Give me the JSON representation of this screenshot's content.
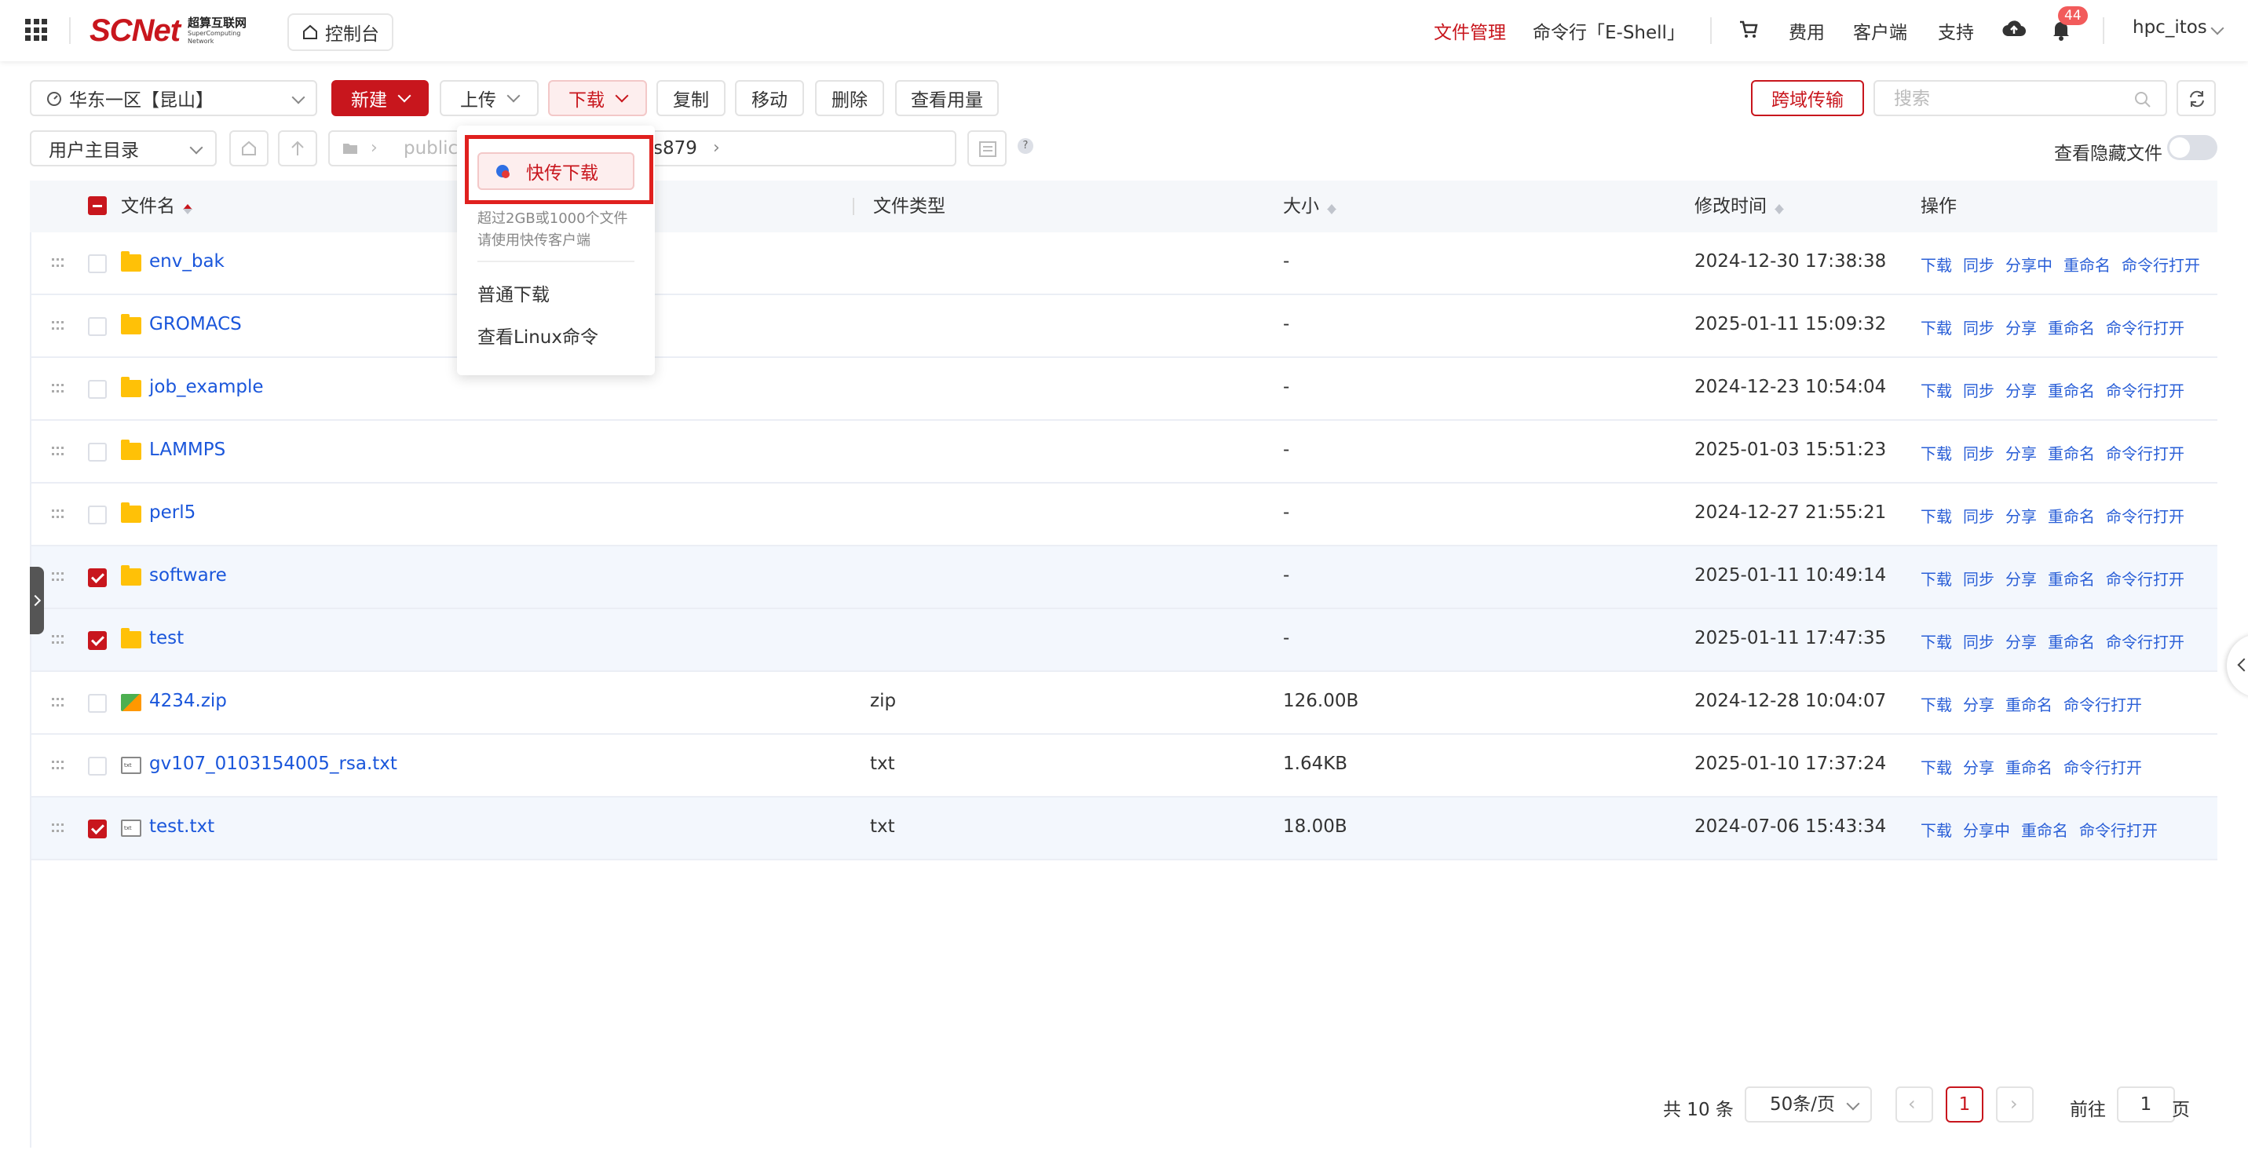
{
  "topbar": {
    "logo_main": "SCNet",
    "logo_cn": "超算互联网",
    "logo_en_1": "SuperComputing",
    "logo_en_2": "Network",
    "console": "控制台",
    "nav": {
      "files": "文件管理",
      "eshell": "命令行「E-Shell」",
      "fees": "费用",
      "client": "客户端",
      "support": "支持",
      "notification_count": "44",
      "user": "hpc_itos"
    }
  },
  "toolbar": {
    "region": "华东一区【昆山】",
    "new": "新建",
    "upload": "上传",
    "download": "下载",
    "copy": "复制",
    "move": "移动",
    "delete": "删除",
    "usage": "查看用量",
    "cross_transfer": "跨域传输",
    "search_placeholder": "搜索",
    "root_select": "用户主目录",
    "path_1": "public",
    "path_2": "s879",
    "show_hidden": "查看隐藏文件",
    "help_mark": "?"
  },
  "dropdown": {
    "fast_download": "快传下载",
    "hint_1": "超过2GB或1000个文件",
    "hint_2": "请使用快传客户端",
    "normal_download": "普通下载",
    "linux_cmd": "查看Linux命令"
  },
  "table": {
    "columns": {
      "name": "文件名",
      "type": "文件类型",
      "size": "大小",
      "mtime": "修改时间",
      "ops": "操作"
    },
    "rows": [
      {
        "name": "env_bak",
        "kind": "folder",
        "type": "",
        "size": "-",
        "mtime": "2024-12-30 17:38:38",
        "checked": false,
        "ops": [
          "下载",
          "同步",
          "分享中",
          "重命名",
          "命令行打开"
        ]
      },
      {
        "name": "GROMACS",
        "kind": "folder",
        "type": "",
        "size": "-",
        "mtime": "2025-01-11 15:09:32",
        "checked": false,
        "ops": [
          "下载",
          "同步",
          "分享",
          "重命名",
          "命令行打开"
        ]
      },
      {
        "name": "job_example",
        "kind": "folder",
        "type": "",
        "size": "-",
        "mtime": "2024-12-23 10:54:04",
        "checked": false,
        "ops": [
          "下载",
          "同步",
          "分享",
          "重命名",
          "命令行打开"
        ]
      },
      {
        "name": "LAMMPS",
        "kind": "folder",
        "type": "",
        "size": "-",
        "mtime": "2025-01-03 15:51:23",
        "checked": false,
        "ops": [
          "下载",
          "同步",
          "分享",
          "重命名",
          "命令行打开"
        ]
      },
      {
        "name": "perl5",
        "kind": "folder",
        "type": "",
        "size": "-",
        "mtime": "2024-12-27 21:55:21",
        "checked": false,
        "ops": [
          "下载",
          "同步",
          "分享",
          "重命名",
          "命令行打开"
        ]
      },
      {
        "name": "software",
        "kind": "folder",
        "type": "",
        "size": "-",
        "mtime": "2025-01-11 10:49:14",
        "checked": true,
        "ops": [
          "下载",
          "同步",
          "分享",
          "重命名",
          "命令行打开"
        ]
      },
      {
        "name": "test",
        "kind": "folder",
        "type": "",
        "size": "-",
        "mtime": "2025-01-11 17:47:35",
        "checked": true,
        "ops": [
          "下载",
          "同步",
          "分享",
          "重命名",
          "命令行打开"
        ]
      },
      {
        "name": "4234.zip",
        "kind": "zip",
        "type": "zip",
        "size": "126.00B",
        "mtime": "2024-12-28 10:04:07",
        "checked": false,
        "ops": [
          "下载",
          "分享",
          "重命名",
          "命令行打开"
        ]
      },
      {
        "name": "gv107_0103154005_rsa.txt",
        "kind": "txt",
        "type": "txt",
        "size": "1.64KB",
        "mtime": "2025-01-10 17:37:24",
        "checked": false,
        "ops": [
          "下载",
          "分享",
          "重命名",
          "命令行打开"
        ]
      },
      {
        "name": "test.txt",
        "kind": "txt",
        "type": "txt",
        "size": "18.00B",
        "mtime": "2024-07-06 15:43:34",
        "checked": true,
        "ops": [
          "下载",
          "分享中",
          "重命名",
          "命令行打开"
        ]
      }
    ]
  },
  "pagination": {
    "total": "共 10 条",
    "page_size": "50条/页",
    "current": "1",
    "goto_label": "前往",
    "goto_value": "1",
    "page_suffix": "页"
  }
}
